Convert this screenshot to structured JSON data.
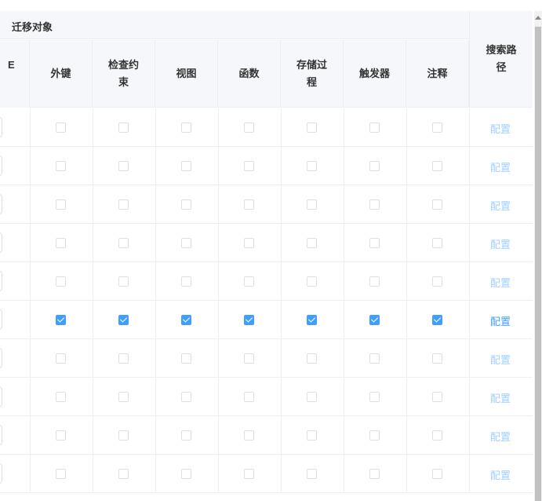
{
  "header": {
    "group_title": "迁移对象",
    "partial_col_label": "E",
    "columns": [
      "外键",
      "检查约束",
      "视图",
      "函数",
      "存储过程",
      "触发器",
      "注释"
    ],
    "search_path": "搜索路径"
  },
  "rows": [
    {
      "checked": false,
      "link": "配置"
    },
    {
      "checked": false,
      "link": "配置"
    },
    {
      "checked": false,
      "link": "配置"
    },
    {
      "checked": false,
      "link": "配置"
    },
    {
      "checked": false,
      "link": "配置"
    },
    {
      "checked": true,
      "link": "配置"
    },
    {
      "checked": false,
      "link": "配置"
    },
    {
      "checked": false,
      "link": "配置"
    },
    {
      "checked": false,
      "link": "配置"
    },
    {
      "checked": false,
      "link": "配置"
    }
  ],
  "colors": {
    "checkbox_checked": "#409eff",
    "link_active": "#409eff",
    "link_muted": "#a0cfff",
    "header_bg": "#f5f7fa"
  }
}
